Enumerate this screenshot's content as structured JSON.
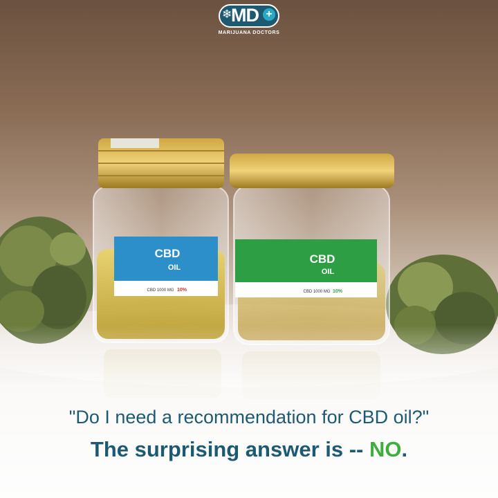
{
  "logo": {
    "letters": "MD",
    "plus": "+",
    "caption": "MARIJUANA DOCTORS",
    "icon": "snowflake-icon"
  },
  "jar_left": {
    "label_title": "CBD",
    "label_sub": "OIL",
    "label_dose": "CBD 1000 MG",
    "label_pct": "10%",
    "label_color": "#2c8fc9"
  },
  "jar_right": {
    "label_title": "CBD",
    "label_sub": "OIL",
    "label_dose": "CBD 1000 MG",
    "label_pct": "10%",
    "label_color": "#2e9e45"
  },
  "headline": "\"Do I need a recommendation for CBD oil?\"",
  "subline": {
    "lead": "The surprising answer is -- ",
    "answer": "NO",
    "trail": "."
  },
  "colors": {
    "brand": "#1d5a72",
    "answer": "#3fae3f"
  }
}
